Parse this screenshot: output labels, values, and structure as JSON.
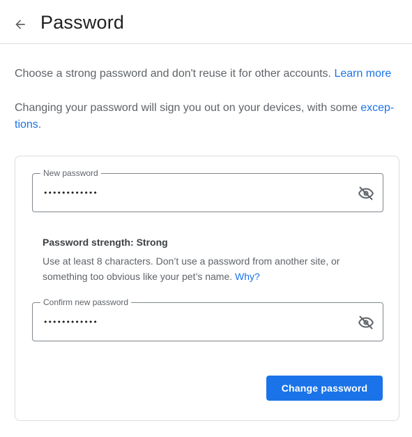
{
  "header": {
    "title": "Password"
  },
  "intro": {
    "text": "Choose a strong password and don't reuse it for other accounts. ",
    "link": "Learn more"
  },
  "signout": {
    "text": "Changing your password will sign you out on your devices, with some ",
    "link": "excep­tions",
    "suffix": "."
  },
  "new_password": {
    "label": "New password",
    "value": "••••••••••••",
    "icon": "eye-off-icon"
  },
  "strength": {
    "text": "Password strength: Strong",
    "hint": "Use at least 8 characters. Don’t use a password from another site, or something too obvious like your pet’s name. ",
    "link": "Why?"
  },
  "confirm_password": {
    "label": "Confirm new password",
    "value": "••••••••••••",
    "icon": "eye-off-icon"
  },
  "actions": {
    "change_label": "Change password"
  },
  "colors": {
    "accent": "#1a73e8",
    "border": "#dadce0",
    "text": "#5f6368"
  }
}
